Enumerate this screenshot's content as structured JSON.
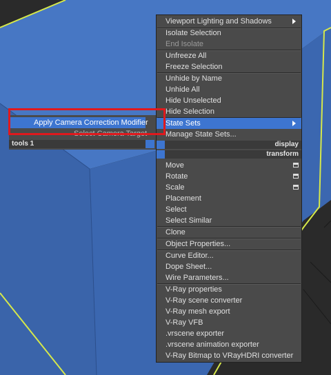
{
  "quad_menu": {
    "right": {
      "items": [
        {
          "label": "Viewport Lighting and Shadows",
          "submenu": true
        },
        {
          "label": "Isolate Selection"
        },
        {
          "label": "End Isolate",
          "disabled": true
        },
        {
          "label": "Unfreeze All"
        },
        {
          "label": "Freeze Selection"
        },
        {
          "label": "Unhide by Name"
        },
        {
          "label": "Unhide All"
        },
        {
          "label": "Hide Unselected"
        },
        {
          "label": "Hide Selection"
        },
        {
          "label": "State Sets",
          "submenu": true,
          "highlighted": true
        },
        {
          "label": "Manage State Sets..."
        }
      ],
      "header_display": "display",
      "header_transform": "transform",
      "transform_items": [
        {
          "label": "Move",
          "options_icon": true
        },
        {
          "label": "Rotate",
          "options_icon": true
        },
        {
          "label": "Scale",
          "options_icon": true
        },
        {
          "label": "Placement"
        },
        {
          "label": "Select"
        },
        {
          "label": "Select Similar"
        },
        {
          "label": "Clone"
        },
        {
          "label": "Object Properties..."
        },
        {
          "label": "Curve Editor..."
        },
        {
          "label": "Dope Sheet..."
        },
        {
          "label": "Wire Parameters..."
        },
        {
          "label": "V-Ray properties"
        },
        {
          "label": "V-Ray scene converter"
        },
        {
          "label": "V-Ray mesh export"
        },
        {
          "label": "V-Ray VFB"
        },
        {
          "label": ".vrscene exporter"
        },
        {
          "label": ".vrscene animation exporter"
        },
        {
          "label": "V-Ray Bitmap to VRayHDRI converter"
        }
      ]
    },
    "left": {
      "items": [
        {
          "label": "Apply Camera Correction Modifier",
          "highlighted": true
        },
        {
          "label": "Select Camera Target"
        }
      ],
      "header": "tools 1"
    }
  },
  "colors": {
    "highlight": "#3d75d0",
    "menu_bg": "#4a4a4a",
    "object_blue": "#3f6ab3",
    "selection_outline": "#d6e84a",
    "annotation_red": "#e0191d"
  }
}
